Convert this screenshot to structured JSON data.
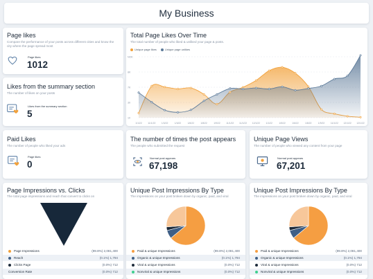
{
  "page_title": "My Business",
  "page_likes": {
    "title": "Page likes",
    "subtitle": "Compare the performance of your posts across different cities and know the city where the page spread most",
    "metric_label": "Page likes",
    "value": "1012"
  },
  "summary_likes": {
    "title": "Likes from the summary section",
    "subtitle": "The number of likes on your posts",
    "metric_label": "Likes from the summary section",
    "value": "5"
  },
  "paid_likes": {
    "title": "Paid Likes",
    "subtitle": "The number of people who liked your ads",
    "metric_label": "Page likes",
    "value": "0"
  },
  "post_appears": {
    "title": "The number of times the post appears",
    "subtitle": "The people who submitted the request",
    "metric_label": "Normal post appears",
    "value": "67,198"
  },
  "unique_views": {
    "title": "Unique Page Views",
    "subtitle": "The number of people who viewed any content from your page",
    "metric_label": "Normal post appears",
    "value": "67,201"
  },
  "total_likes_chart": {
    "title": "Total Page Likes Over Time",
    "subtitle": "The total number of people who liked & unliked your page & posts.",
    "chart_data": {
      "type": "area",
      "series": [
        {
          "name": "Unique page likes",
          "color": "#f2a23c",
          "values": [
            1.9,
            13.0,
            12.6,
            11.8,
            12.2,
            9.6,
            5.6,
            10.5,
            12.5,
            15.3,
            19.3,
            20.7,
            18.3,
            12.8,
            3.4,
            1.6,
            0.6,
            0.2
          ]
        },
        {
          "name": "Unique page unlikes",
          "color": "#5c7a99",
          "values": [
            10.3,
            6.4,
            3.1,
            2.2,
            3.2,
            6.9,
            9.6,
            12.0,
            11.8,
            12.2,
            11.8,
            12.7,
            11.3,
            12.0,
            13.0,
            15.9,
            17.2,
            25.6
          ]
        }
      ],
      "ylabels": [
        "10",
        "30",
        "7K",
        "8K",
        "NOK"
      ],
      "xlabels": [
        "1/1/22",
        "11/1/22",
        "1/3/22",
        "1/3/22",
        "1/6/22",
        "1/8/22",
        "1/9/22",
        "11/1/22",
        "11/1/22",
        "12/1/22",
        "1/1/22",
        "1/5/22",
        "1/6/22",
        "1/8/22",
        "1/9/22",
        "11/1/22",
        "12/1/22",
        "12/1/22"
      ],
      "ylim": [
        0,
        25
      ]
    }
  },
  "impressions_clicks": {
    "title": "Page Impressions vs. Clicks",
    "subtitle": "The total page impressions and reach  that convert to clicks on",
    "chart_data": {
      "type": "funnel",
      "rows": [
        {
          "label": "Page Impressions",
          "value": "(99.8%) 2,081,400",
          "color": "#f2a23c"
        },
        {
          "label": "Reach",
          "value": "(0.1%) 1,794",
          "color": "#3f5f86"
        },
        {
          "label": "Clicks Page",
          "value": "(0.0%) 712",
          "color": "#1c2a3a"
        },
        {
          "label": "Conversion Rate",
          "value": "(0.0%) 712",
          "color": ""
        }
      ]
    }
  },
  "post_impressions_1": {
    "title": "Unique Post Impressions By Type",
    "subtitle": "The impressions on your post broken down by organic, paid, and viral",
    "chart_data": {
      "type": "pie",
      "slices": [
        {
          "label": "Paid & unique Impressions",
          "value": "(99.8%) 2,081,400",
          "color": "#f59e42"
        },
        {
          "label": "Organic & unique Impressions",
          "value": "(0.1%) 1,794",
          "color": "#3f5f86"
        },
        {
          "label": "Viral & unique Impressions",
          "value": "(0.0%) 712",
          "color": "#1c2a3a"
        },
        {
          "label": "Nonviral & unique Impressions",
          "value": "(0.0%) 712",
          "color": "#3ecf8e"
        }
      ]
    }
  },
  "post_impressions_2": {
    "title": "Unique Post Impressions By Type",
    "subtitle": "The impressions on your post broken down by organic, paid, and viral",
    "chart_data": {
      "type": "pie",
      "slices": [
        {
          "label": "Paid & unique Impressions",
          "value": "(99.8%) 2,081,400",
          "color": "#f59e42"
        },
        {
          "label": "Organic & unique Impressions",
          "value": "(0.1%) 1,794",
          "color": "#3f5f86"
        },
        {
          "label": "Viral & unique Impressions",
          "value": "(0.0%) 712",
          "color": "#1c2a3a"
        },
        {
          "label": "Nonviral & unique Impressions",
          "value": "(0.0%) 712",
          "color": "#3ecf8e"
        }
      ]
    }
  }
}
